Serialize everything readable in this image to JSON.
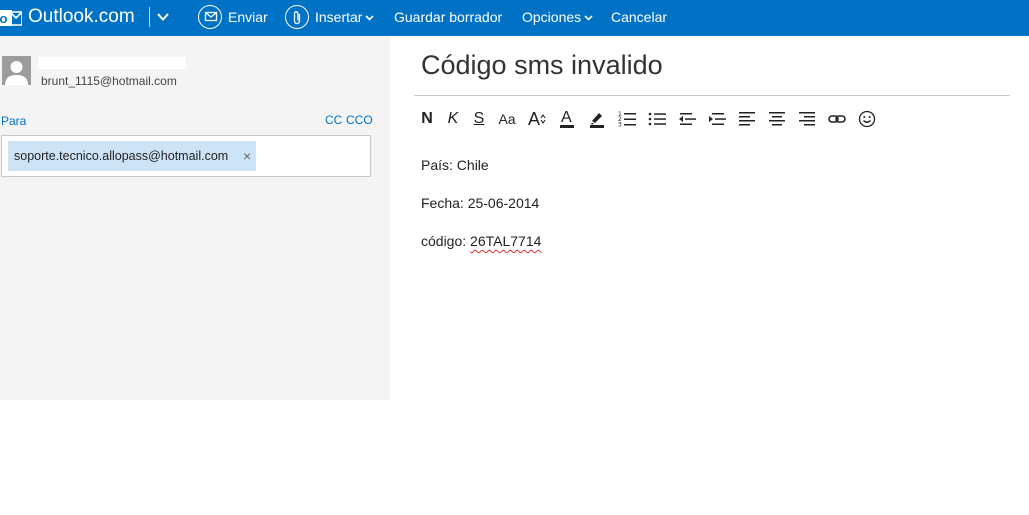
{
  "app": {
    "brand": "Outlook.com"
  },
  "toolbar": {
    "send_label": "Enviar",
    "insert_label": "Insertar",
    "save_draft_label": "Guardar borrador",
    "options_label": "Opciones",
    "cancel_label": "Cancelar"
  },
  "sender": {
    "email": "brunt_1115@hotmail.com"
  },
  "recipients": {
    "to_label": "Para",
    "cc_label": "CC",
    "bcc_label": "CCO",
    "chips": [
      {
        "address": "soporte.tecnico.allopass@hotmail.com",
        "remove_glyph": "×"
      }
    ]
  },
  "message": {
    "subject": "Código sms invalido",
    "body": {
      "line1": "País: Chile",
      "line2": "Fecha: 25-06-2014",
      "line3_prefix": "código: ",
      "line3_code": "26TAL7714"
    }
  },
  "format_toolbar": {
    "bold_glyph": "N",
    "italic_glyph": "K",
    "strike_glyph": "S",
    "font_size_glyph": "Aa",
    "grow_glyph": "A",
    "font_color_glyph": "A",
    "icons": [
      "bold-icon",
      "italic-icon",
      "strikethrough-icon",
      "font-size-icon",
      "grow-font-icon",
      "font-color-icon",
      "highlight-icon",
      "numbered-list-icon",
      "bullet-list-icon",
      "decrease-indent-icon",
      "increase-indent-icon",
      "align-left-icon",
      "align-center-icon",
      "align-right-icon",
      "link-icon",
      "emoji-icon"
    ]
  },
  "colors": {
    "topbar": "#0072c6",
    "link": "#0072c6",
    "chip": "#cde4f7",
    "panel": "#f4f4f4"
  }
}
